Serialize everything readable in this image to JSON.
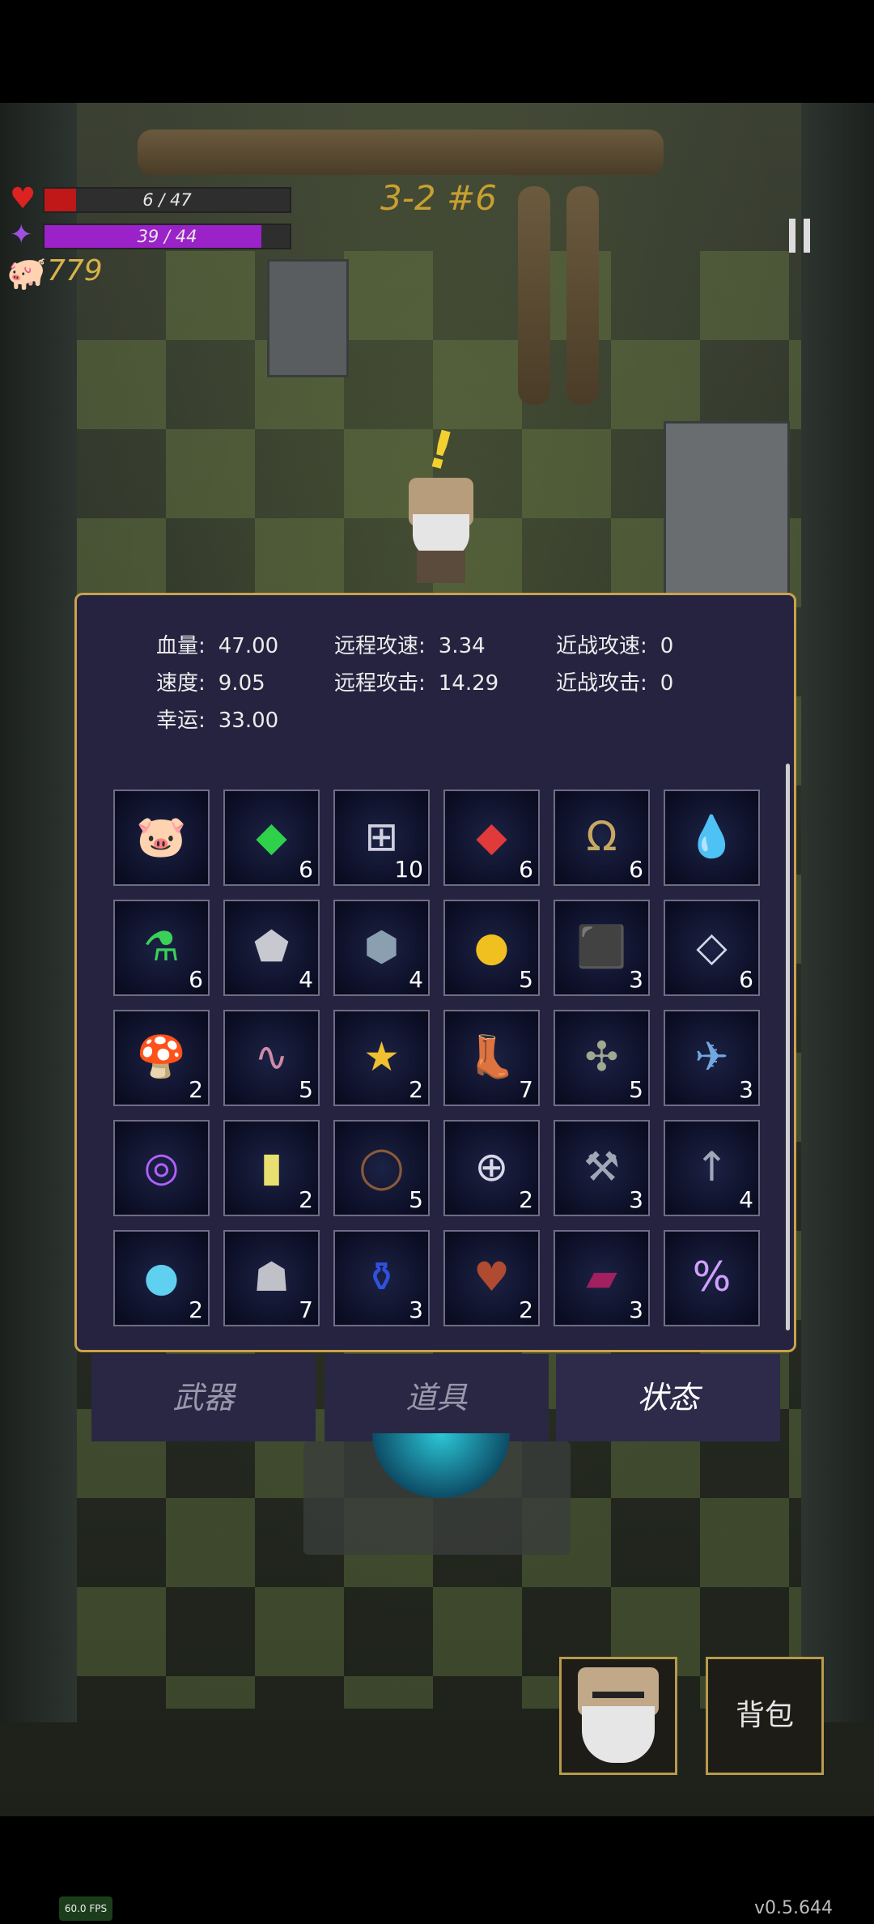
{
  "hud": {
    "hp_text": "6 / 47",
    "hp_fraction": 0.128,
    "mp_text": "39 / 44",
    "mp_fraction": 0.886,
    "coins": "779",
    "level": "3-2 #6"
  },
  "stats": {
    "hp_label": "血量:",
    "hp_value": "47.00",
    "speed_label": "速度:",
    "speed_value": "9.05",
    "luck_label": "幸运:",
    "luck_value": "33.00",
    "ranged_speed_label": "远程攻速:",
    "ranged_speed_value": "3.34",
    "ranged_atk_label": "远程攻击:",
    "ranged_atk_value": "14.29",
    "melee_speed_label": "近战攻速:",
    "melee_speed_value": "0",
    "melee_atk_label": "近战攻击:",
    "melee_atk_value": "0"
  },
  "items": [
    {
      "icon": "piggy-bank-icon",
      "glyph": "🐷",
      "count": ""
    },
    {
      "icon": "green-crystal-icon",
      "glyph": "◆",
      "color": "#2fd04a",
      "count": "6"
    },
    {
      "icon": "medkit-icon",
      "glyph": "⊞",
      "color": "#d0d0e0",
      "count": "10"
    },
    {
      "icon": "red-crystal-icon",
      "glyph": "◆",
      "color": "#e03a3a",
      "count": "6"
    },
    {
      "icon": "horseshoe-icon",
      "glyph": "Ω",
      "color": "#c8a860",
      "count": "6"
    },
    {
      "icon": "water-drop-icon",
      "glyph": "💧",
      "count": ""
    },
    {
      "icon": "green-potion-icon",
      "glyph": "⚗",
      "color": "#3ad05a",
      "count": "6"
    },
    {
      "icon": "silver-ore-icon",
      "glyph": "⬟",
      "color": "#c8c8d0",
      "count": "4"
    },
    {
      "icon": "stone-icon",
      "glyph": "⬢",
      "color": "#8aa0b0",
      "count": "4"
    },
    {
      "icon": "gold-coin-icon",
      "glyph": "●",
      "color": "#f0c020",
      "count": "5"
    },
    {
      "icon": "ore-chunks-icon",
      "glyph": "⬛",
      "color": "#c8b070",
      "count": "3"
    },
    {
      "icon": "diamond-frame-icon",
      "glyph": "◇",
      "color": "#d0d8e8",
      "count": "6"
    },
    {
      "icon": "mushroom-icon",
      "glyph": "🍄",
      "count": "2"
    },
    {
      "icon": "worm-icon",
      "glyph": "∿",
      "color": "#d08aa8",
      "count": "5"
    },
    {
      "icon": "star-trophy-icon",
      "glyph": "★",
      "color": "#f0c030",
      "count": "2"
    },
    {
      "icon": "boots-icon",
      "glyph": "👢",
      "count": "7"
    },
    {
      "icon": "squid-icon",
      "glyph": "✣",
      "color": "#a0a890",
      "count": "5"
    },
    {
      "icon": "dragonfly-icon",
      "glyph": "✈",
      "color": "#70a8e0",
      "count": "3"
    },
    {
      "icon": "purple-swirl-icon",
      "glyph": "◎",
      "color": "#b060ff",
      "count": ""
    },
    {
      "icon": "yellow-card-icon",
      "glyph": "▮",
      "color": "#e8e070",
      "count": "2"
    },
    {
      "icon": "thorn-crown-icon",
      "glyph": "◯",
      "color": "#8a5a3a",
      "count": "5"
    },
    {
      "icon": "health-ring-icon",
      "glyph": "⊕",
      "color": "#d8d8e8",
      "count": "2"
    },
    {
      "icon": "hammer-icon",
      "glyph": "⚒",
      "color": "#a0a8b8",
      "count": "3"
    },
    {
      "icon": "arrow-up-icon",
      "glyph": "↑",
      "color": "#a0a8b8",
      "count": "4"
    },
    {
      "icon": "crystal-orb-icon",
      "glyph": "●",
      "color": "#60d0f0",
      "count": "2"
    },
    {
      "icon": "cloak-icon",
      "glyph": "☗",
      "color": "#c0c0c8",
      "count": "7"
    },
    {
      "icon": "blue-potion-icon",
      "glyph": "⚱",
      "color": "#3050e0",
      "count": "3"
    },
    {
      "icon": "heart-gold-icon",
      "glyph": "♥",
      "color": "#b04a30",
      "count": "2"
    },
    {
      "icon": "spellbook-icon",
      "glyph": "▰",
      "color": "#a02060",
      "count": "3"
    },
    {
      "icon": "percent-rune-icon",
      "glyph": "%",
      "color": "#d0a0ff",
      "count": ""
    }
  ],
  "tabs": {
    "weapons": "武器",
    "items": "道具",
    "status": "状态"
  },
  "buttons": {
    "bag": "背包"
  },
  "footer": {
    "fps": "60.0 FPS",
    "version": "v0.5.644"
  }
}
